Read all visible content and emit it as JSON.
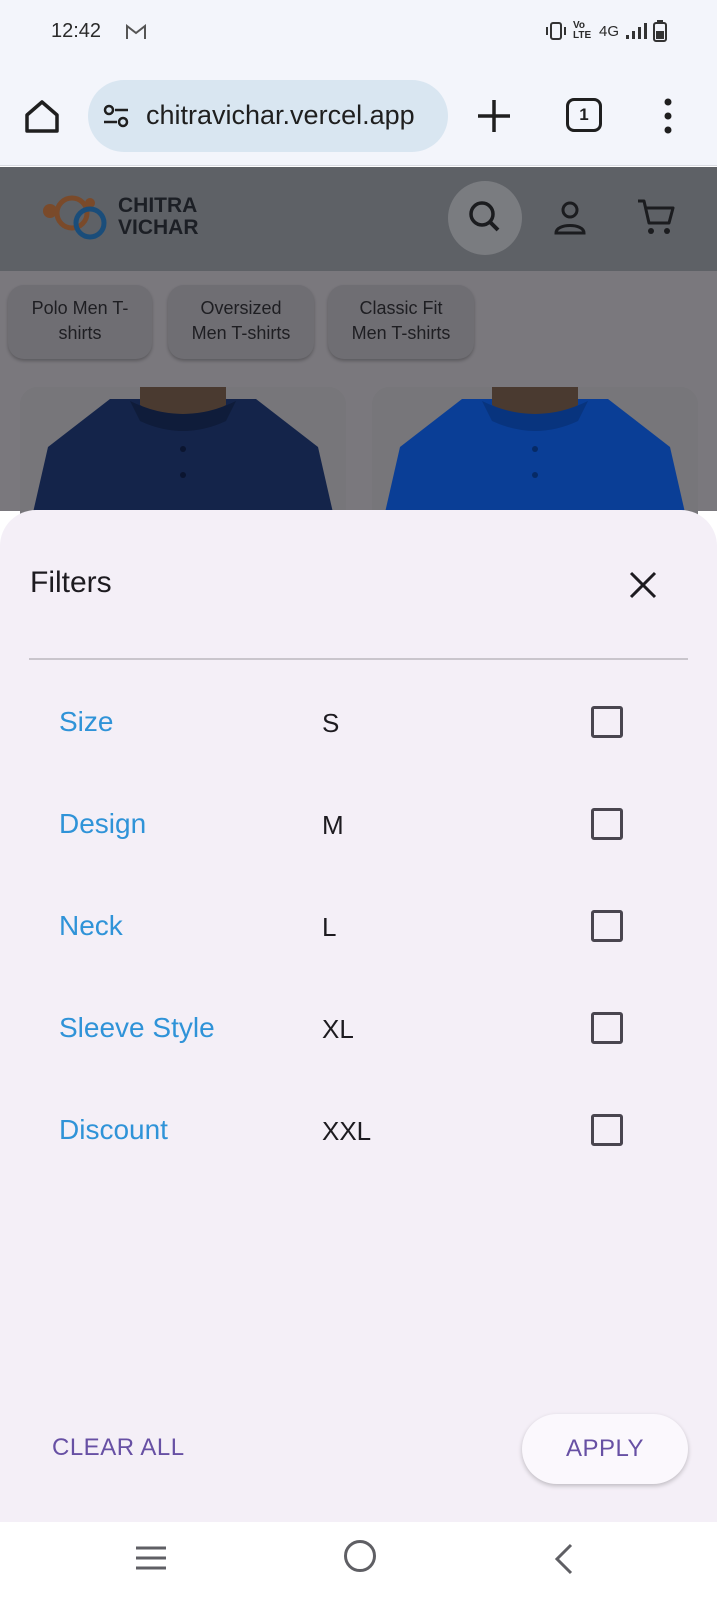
{
  "status_bar": {
    "time": "12:42",
    "network": "4G",
    "volte": "Vo LTE"
  },
  "browser": {
    "url": "chitravichar.vercel.app",
    "tab_count": "1"
  },
  "site": {
    "logo_line1": "CHITRA",
    "logo_line2": "VICHAR"
  },
  "categories_chips": [
    {
      "line1": "Polo Men T-",
      "line2": "shirts"
    },
    {
      "line1": "Oversized",
      "line2": "Men T-shirts"
    },
    {
      "line1": "Classic Fit",
      "line2": "Men T-shirts"
    }
  ],
  "filters": {
    "title": "Filters",
    "categories": [
      "Size",
      "Design",
      "Neck",
      "Sleeve Style",
      "Discount"
    ],
    "options": [
      "S",
      "M",
      "L",
      "XL",
      "XXL"
    ],
    "clear_label": "CLEAR ALL",
    "apply_label": "APPLY"
  },
  "colors": {
    "category_text": "#2f93d8",
    "action_text": "#6750a4",
    "sheet_bg": "#f4eff7",
    "shirt_navy": "#14244a",
    "shirt_royal": "#0a3e96"
  }
}
